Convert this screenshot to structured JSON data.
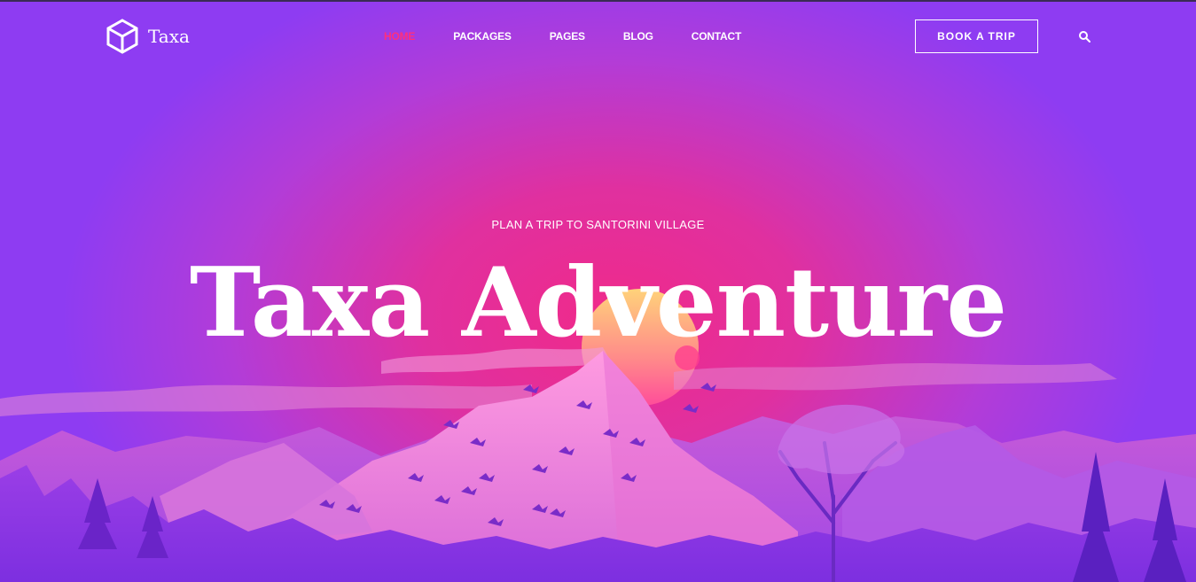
{
  "brand": {
    "name": "Taxa",
    "logo_icon": "cube-outline-icon"
  },
  "nav": {
    "items": [
      {
        "label": "HOME",
        "active": true
      },
      {
        "label": "PACKAGES",
        "active": false
      },
      {
        "label": "PAGES",
        "active": false
      },
      {
        "label": "BLOG",
        "active": false
      },
      {
        "label": "CONTACT",
        "active": false
      }
    ],
    "active_color": "#ff2f7d"
  },
  "header": {
    "book_label": "BOOK A TRIP",
    "search_icon": "search-icon"
  },
  "hero": {
    "subtitle": "PLAN A TRIP TO SANTORINI VILLAGE",
    "title": "Taxa Adventure",
    "colors": {
      "sky_center": "#f02a8a",
      "sky_edge": "#8e3cf2",
      "mountain": "#f07fd6",
      "forest": "#7a2ed8"
    }
  }
}
